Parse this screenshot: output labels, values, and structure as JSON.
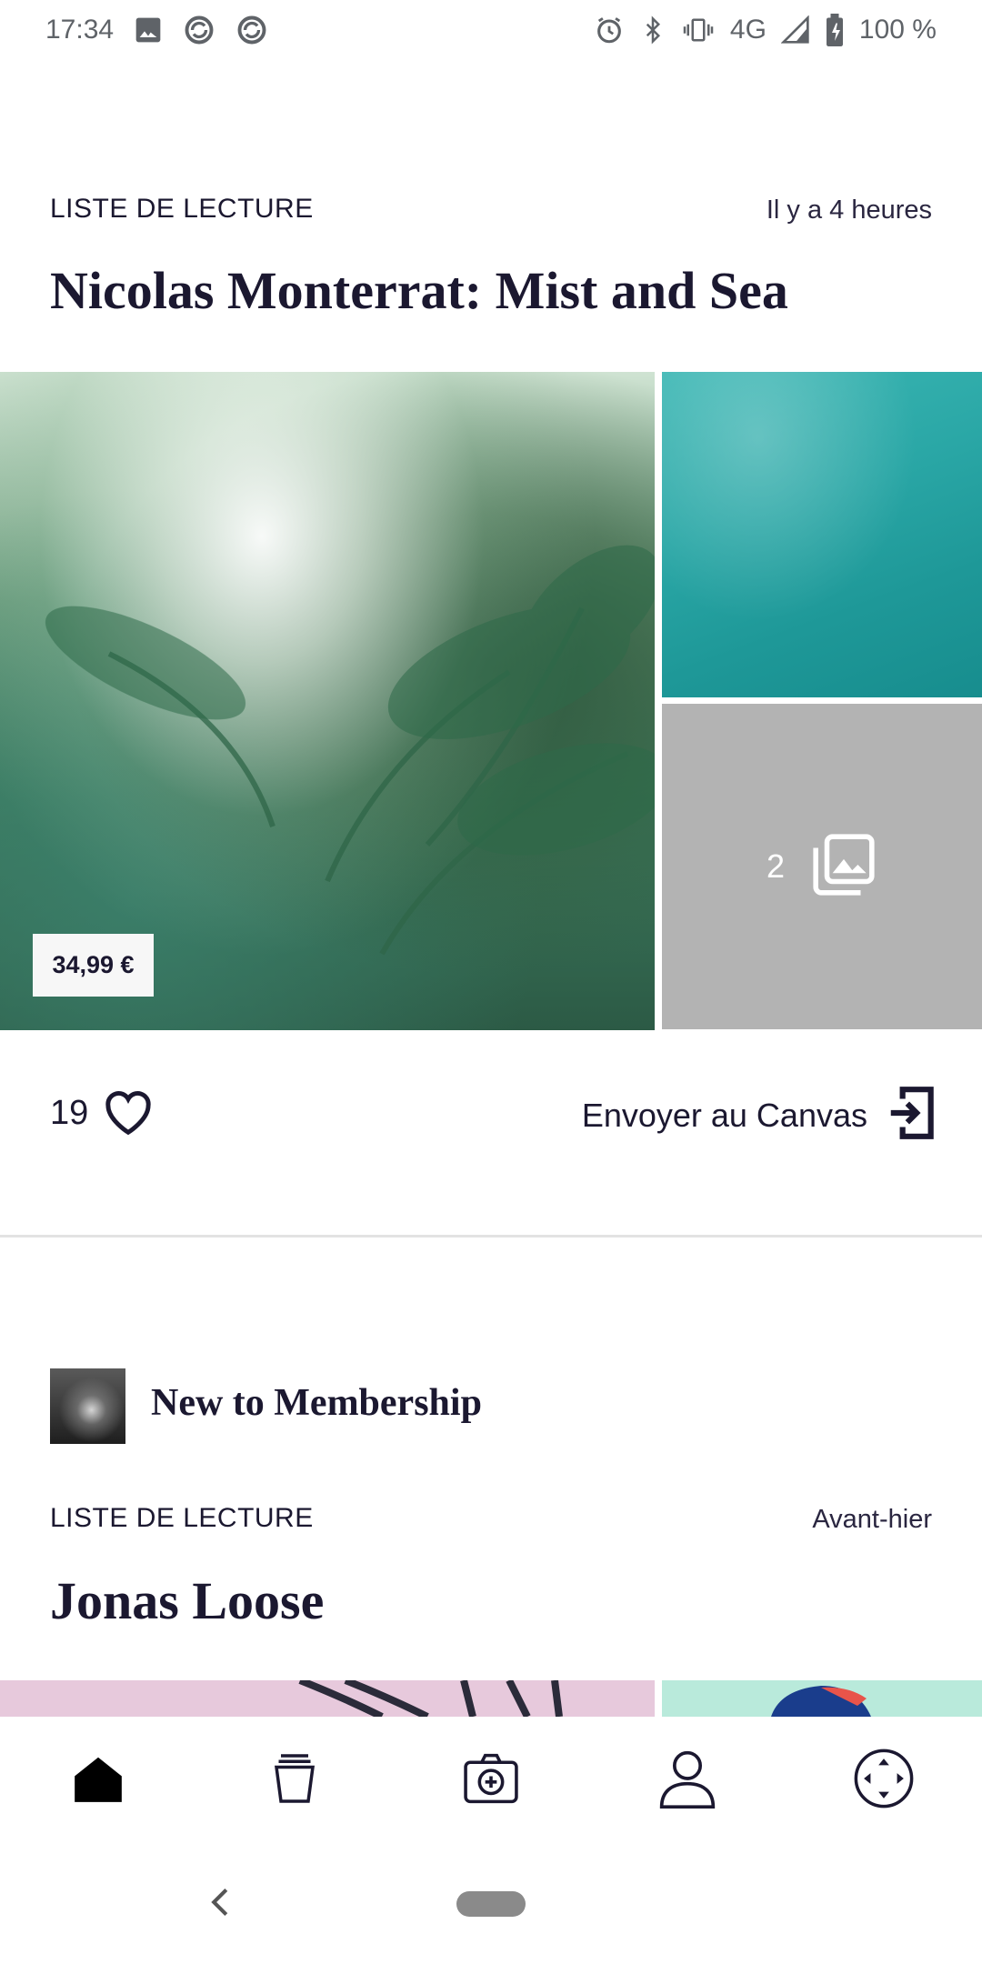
{
  "status_bar": {
    "time": "17:34",
    "network": "4G",
    "battery": "100 %",
    "icons_left": [
      "image-icon",
      "sync-icon",
      "sync-icon"
    ],
    "icons_right": [
      "alarm-icon",
      "bluetooth-icon",
      "vibrate-icon",
      "signal-icon",
      "battery-icon"
    ]
  },
  "card1": {
    "label": "LISTE DE LECTURE",
    "time": "Il y a 4 heures",
    "title": "Nicolas Monterrat: Mist and Sea",
    "price": "34,99 €",
    "more_count": "2",
    "likes": "19",
    "send_label": "Envoyer au Canvas"
  },
  "card2": {
    "member_title": "New to Membership",
    "label": "LISTE DE LECTURE",
    "time": "Avant-hier",
    "title": "Jonas Loose"
  },
  "bottom_nav": {
    "items": [
      "home-icon",
      "collection-icon",
      "camera-add-icon",
      "profile-icon",
      "canvas-control-icon"
    ]
  },
  "colors": {
    "text_dark": "#1b1830",
    "divider": "#e3e3e3",
    "overlay_gray": "#b3b3b3"
  }
}
